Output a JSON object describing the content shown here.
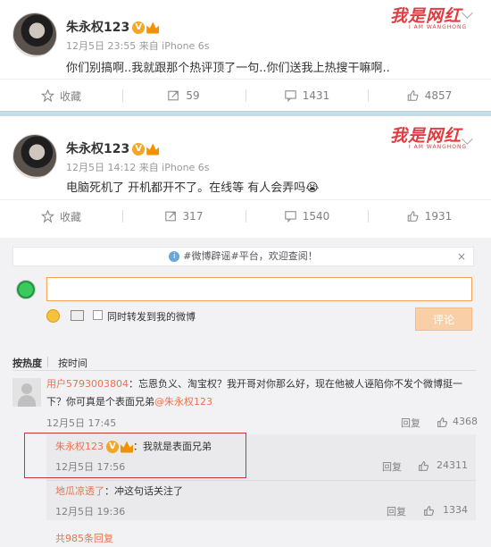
{
  "posts": [
    {
      "username": "朱永权123",
      "meta": "12月5日 23:55 来自 iPhone 6s",
      "text": "你们别搞啊..我就跟那个热评顶了一句..你们送我上热搜干嘛啊..",
      "actions": {
        "favorite": "收藏",
        "repost": "59",
        "comment": "1431",
        "like": "4857"
      }
    },
    {
      "username": "朱永权123",
      "meta": "12月5日 14:12 来自 iPhone 6s",
      "text": "电脑死机了 开机都开不了。在线等 有人会弄吗😭",
      "actions": {
        "favorite": "收藏",
        "repost": "317",
        "comment": "1540",
        "like": "1931"
      }
    }
  ],
  "watermark": {
    "main": "我是网红",
    "sub": "I AM WANGHONG"
  },
  "badge": {
    "verified": "V"
  },
  "notice": {
    "text": "#微博辟谣#平台，欢迎查阅！",
    "close": "×",
    "info": "i"
  },
  "composer": {
    "input_value": "",
    "repost_label": "同时转发到我的微博",
    "submit_label": "评论"
  },
  "sort_tabs": {
    "hot": "按热度",
    "time": "按时间"
  },
  "comments": [
    {
      "user": "用户5793003804",
      "text_line1": "：忘恩负义、淘宝权？我开哥对你那么好，现在他被人诬陷你不发个微博挺一",
      "text_line2_pre": "下？你可真是个表面兄弟",
      "mention": "@朱永权123",
      "time": "12月5日 17:45",
      "reply": "回复",
      "likes": "4368"
    }
  ],
  "replies": [
    {
      "user": "朱永权123",
      "text": "：我就是表面兄弟",
      "time": "12月5日 17:56",
      "reply": "回复",
      "likes": "24311"
    },
    {
      "user": "地瓜凉透了",
      "text": "：冲这句话关注了",
      "time": "12月5日 19:36",
      "reply": "回复",
      "likes": "1334"
    }
  ],
  "more_replies": "共985条回复",
  "colors": {
    "accent": "#eb7350",
    "divider": "#c8dde8",
    "highlight": "#c8363b"
  }
}
